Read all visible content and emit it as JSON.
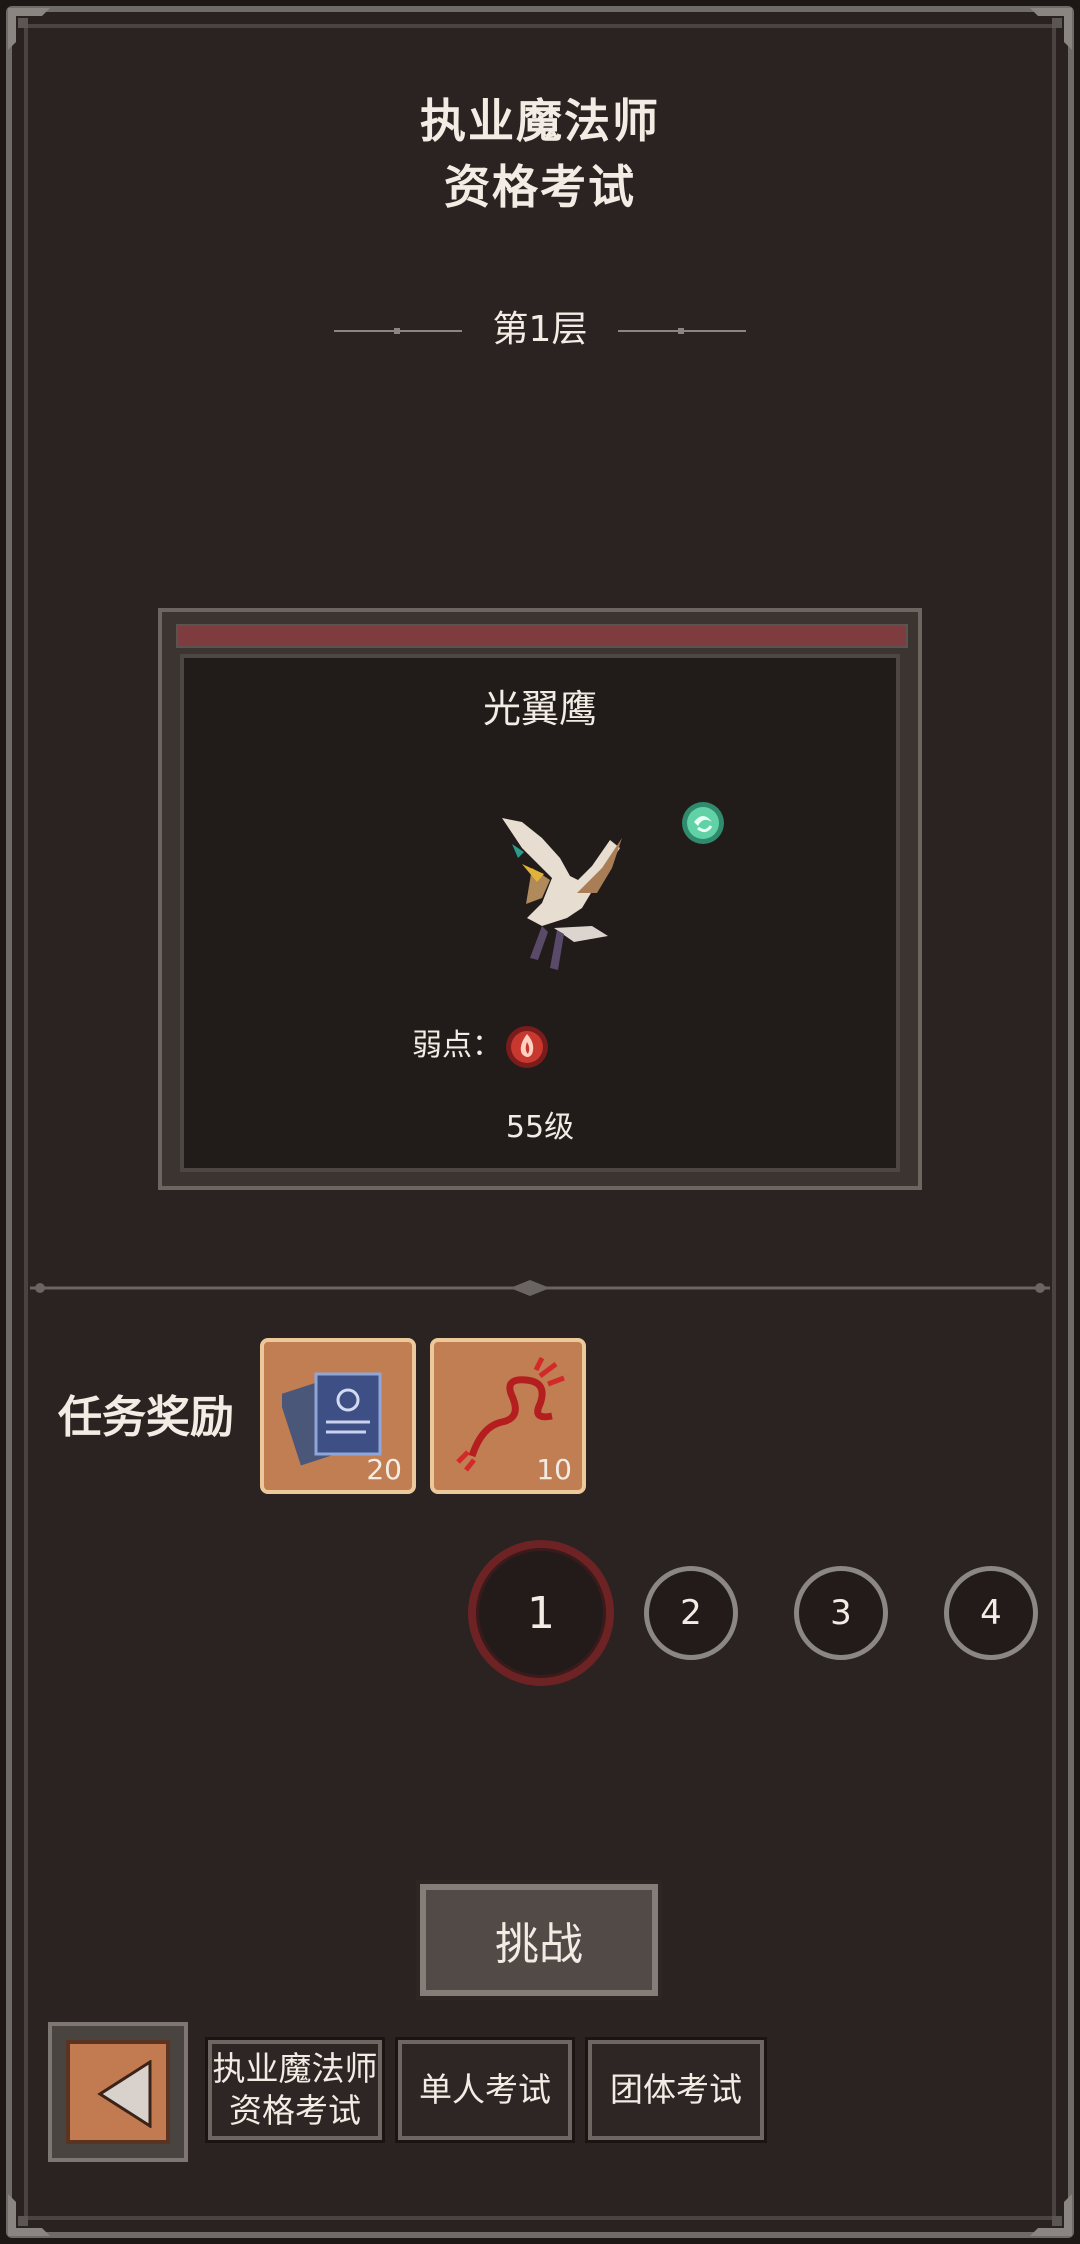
{
  "header": {
    "title_line1": "执业魔法师",
    "title_line2": "资格考试",
    "floor": "第1层"
  },
  "enemy": {
    "name": "光翼鹰",
    "element_icon": "wind-orb-icon",
    "weakness_label": "弱点：",
    "weakness_icon": "fire-orb-icon",
    "level": "55级"
  },
  "rewards": {
    "label": "任务奖励",
    "items": [
      {
        "icon": "scroll-documents-icon",
        "count": "20"
      },
      {
        "icon": "red-thread-icon",
        "count": "10"
      }
    ]
  },
  "pager": {
    "pages": [
      "1",
      "2",
      "3",
      "4"
    ],
    "selected": "1"
  },
  "challenge_label": "挑战",
  "bottom_tabs": {
    "back_icon": "back-arrow-icon",
    "tab1": "执业魔法师\n资格考试",
    "tab2": "单人考试",
    "tab3": "团体考试"
  },
  "colors": {
    "background": "#2b2321",
    "accent_red": "#7e3c3f",
    "reward_tile": "#c17e52"
  }
}
